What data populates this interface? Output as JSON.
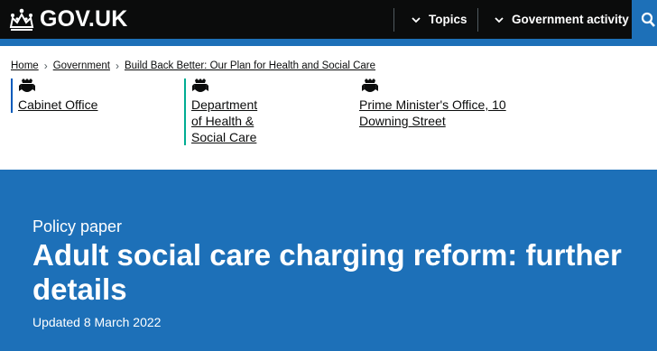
{
  "header": {
    "logo_text": "GOV.UK",
    "nav": [
      {
        "label": "Topics",
        "icon": "chevron-down-icon"
      },
      {
        "label": "Government activity",
        "icon": "chevron-down-icon"
      }
    ],
    "search_icon": "search-icon",
    "colors": {
      "background": "#0b0c0c",
      "accent": "#1d70b8"
    }
  },
  "breadcrumbs": [
    "Home",
    "Government",
    "Build Back Better: Our Plan for Health and Social Care"
  ],
  "organisations": [
    {
      "lines": [
        "Cabinet Office"
      ],
      "icon": "crest-icon",
      "color": "#005abb"
    },
    {
      "lines": [
        "Department",
        "of Health &",
        "Social Care"
      ],
      "icon": "crest-icon",
      "color": "#00ad93"
    },
    {
      "lines": [
        "Prime Minister's Office, 10",
        "Downing Street"
      ],
      "icon": "crest-icon",
      "color": ""
    }
  ],
  "hero": {
    "doc_type": "Policy paper",
    "title": "Adult social care charging reform: further details",
    "updated": "Updated 8 March 2022",
    "background": "#1d70b8"
  }
}
